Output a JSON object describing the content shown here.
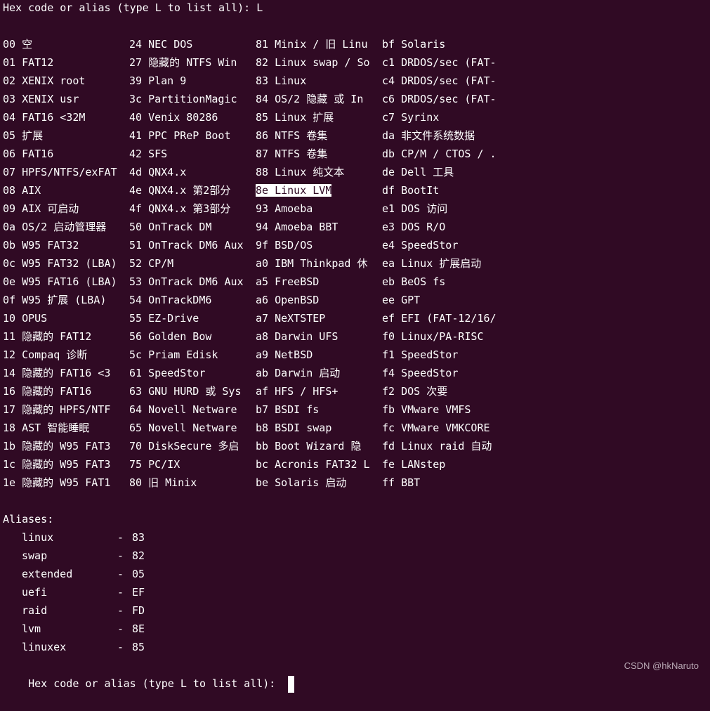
{
  "prompt": "Hex code or alias (type L to list all): L",
  "final_prompt": "Hex code or alias (type L to list all): ",
  "table": {
    "rows": [
      [
        {
          "code": "00",
          "name": "空"
        },
        {
          "code": "24",
          "name": "NEC DOS"
        },
        {
          "code": "81",
          "name": "Minix / 旧 Linu"
        },
        {
          "code": "bf",
          "name": "Solaris"
        }
      ],
      [
        {
          "code": "01",
          "name": "FAT12"
        },
        {
          "code": "27",
          "name": "隐藏的 NTFS Win"
        },
        {
          "code": "82",
          "name": "Linux swap / So"
        },
        {
          "code": "c1",
          "name": "DRDOS/sec (FAT-"
        }
      ],
      [
        {
          "code": "02",
          "name": "XENIX root"
        },
        {
          "code": "39",
          "name": "Plan 9"
        },
        {
          "code": "83",
          "name": "Linux"
        },
        {
          "code": "c4",
          "name": "DRDOS/sec (FAT-"
        }
      ],
      [
        {
          "code": "03",
          "name": "XENIX usr"
        },
        {
          "code": "3c",
          "name": "PartitionMagic"
        },
        {
          "code": "84",
          "name": "OS/2 隐藏 或 In"
        },
        {
          "code": "c6",
          "name": "DRDOS/sec (FAT-"
        }
      ],
      [
        {
          "code": "04",
          "name": "FAT16 <32M"
        },
        {
          "code": "40",
          "name": "Venix 80286"
        },
        {
          "code": "85",
          "name": "Linux 扩展"
        },
        {
          "code": "c7",
          "name": "Syrinx"
        }
      ],
      [
        {
          "code": "05",
          "name": "扩展"
        },
        {
          "code": "41",
          "name": "PPC PReP Boot"
        },
        {
          "code": "86",
          "name": "NTFS 卷集"
        },
        {
          "code": "da",
          "name": "非文件系统数据"
        }
      ],
      [
        {
          "code": "06",
          "name": "FAT16"
        },
        {
          "code": "42",
          "name": "SFS"
        },
        {
          "code": "87",
          "name": "NTFS 卷集"
        },
        {
          "code": "db",
          "name": "CP/M / CTOS / ."
        }
      ],
      [
        {
          "code": "07",
          "name": "HPFS/NTFS/exFAT"
        },
        {
          "code": "4d",
          "name": "QNX4.x"
        },
        {
          "code": "88",
          "name": "Linux 纯文本"
        },
        {
          "code": "de",
          "name": "Dell 工具"
        }
      ],
      [
        {
          "code": "08",
          "name": "AIX"
        },
        {
          "code": "4e",
          "name": "QNX4.x 第2部分"
        },
        {
          "code": "8e",
          "name": "Linux LVM"
        },
        {
          "code": "df",
          "name": "BootIt"
        }
      ],
      [
        {
          "code": "09",
          "name": "AIX 可启动"
        },
        {
          "code": "4f",
          "name": "QNX4.x 第3部分"
        },
        {
          "code": "93",
          "name": "Amoeba"
        },
        {
          "code": "e1",
          "name": "DOS 访问"
        }
      ],
      [
        {
          "code": "0a",
          "name": "OS/2 启动管理器"
        },
        {
          "code": "50",
          "name": "OnTrack DM"
        },
        {
          "code": "94",
          "name": "Amoeba BBT"
        },
        {
          "code": "e3",
          "name": "DOS R/O"
        }
      ],
      [
        {
          "code": "0b",
          "name": "W95 FAT32"
        },
        {
          "code": "51",
          "name": "OnTrack DM6 Aux"
        },
        {
          "code": "9f",
          "name": "BSD/OS"
        },
        {
          "code": "e4",
          "name": "SpeedStor"
        }
      ],
      [
        {
          "code": "0c",
          "name": "W95 FAT32 (LBA)"
        },
        {
          "code": "52",
          "name": "CP/M"
        },
        {
          "code": "a0",
          "name": "IBM Thinkpad 休"
        },
        {
          "code": "ea",
          "name": "Linux 扩展启动"
        }
      ],
      [
        {
          "code": "0e",
          "name": "W95 FAT16 (LBA)"
        },
        {
          "code": "53",
          "name": "OnTrack DM6 Aux"
        },
        {
          "code": "a5",
          "name": "FreeBSD"
        },
        {
          "code": "eb",
          "name": "BeOS fs"
        }
      ],
      [
        {
          "code": "0f",
          "name": "W95 扩展 (LBA)"
        },
        {
          "code": "54",
          "name": "OnTrackDM6"
        },
        {
          "code": "a6",
          "name": "OpenBSD"
        },
        {
          "code": "ee",
          "name": "GPT"
        }
      ],
      [
        {
          "code": "10",
          "name": "OPUS"
        },
        {
          "code": "55",
          "name": "EZ-Drive"
        },
        {
          "code": "a7",
          "name": "NeXTSTEP"
        },
        {
          "code": "ef",
          "name": "EFI (FAT-12/16/"
        }
      ],
      [
        {
          "code": "11",
          "name": "隐藏的 FAT12"
        },
        {
          "code": "56",
          "name": "Golden Bow"
        },
        {
          "code": "a8",
          "name": "Darwin UFS"
        },
        {
          "code": "f0",
          "name": "Linux/PA-RISC"
        }
      ],
      [
        {
          "code": "12",
          "name": "Compaq 诊断"
        },
        {
          "code": "5c",
          "name": "Priam Edisk"
        },
        {
          "code": "a9",
          "name": "NetBSD"
        },
        {
          "code": "f1",
          "name": "SpeedStor"
        }
      ],
      [
        {
          "code": "14",
          "name": "隐藏的 FAT16 <3"
        },
        {
          "code": "61",
          "name": "SpeedStor"
        },
        {
          "code": "ab",
          "name": "Darwin 启动"
        },
        {
          "code": "f4",
          "name": "SpeedStor"
        }
      ],
      [
        {
          "code": "16",
          "name": "隐藏的 FAT16"
        },
        {
          "code": "63",
          "name": "GNU HURD 或 Sys"
        },
        {
          "code": "af",
          "name": "HFS / HFS+"
        },
        {
          "code": "f2",
          "name": "DOS 次要"
        }
      ],
      [
        {
          "code": "17",
          "name": "隐藏的 HPFS/NTF"
        },
        {
          "code": "64",
          "name": "Novell Netware"
        },
        {
          "code": "b7",
          "name": "BSDI fs"
        },
        {
          "code": "fb",
          "name": "VMware VMFS"
        }
      ],
      [
        {
          "code": "18",
          "name": "AST 智能睡眠"
        },
        {
          "code": "65",
          "name": "Novell Netware"
        },
        {
          "code": "b8",
          "name": "BSDI swap"
        },
        {
          "code": "fc",
          "name": "VMware VMKCORE"
        }
      ],
      [
        {
          "code": "1b",
          "name": "隐藏的 W95 FAT3"
        },
        {
          "code": "70",
          "name": "DiskSecure 多启"
        },
        {
          "code": "bb",
          "name": "Boot Wizard 隐"
        },
        {
          "code": "fd",
          "name": "Linux raid 自动"
        }
      ],
      [
        {
          "code": "1c",
          "name": "隐藏的 W95 FAT3"
        },
        {
          "code": "75",
          "name": "PC/IX"
        },
        {
          "code": "bc",
          "name": "Acronis FAT32 L"
        },
        {
          "code": "fe",
          "name": "LANstep"
        }
      ],
      [
        {
          "code": "1e",
          "name": "隐藏的 W95 FAT1"
        },
        {
          "code": "80",
          "name": "旧 Minix"
        },
        {
          "code": "be",
          "name": "Solaris 启动"
        },
        {
          "code": "ff",
          "name": "BBT"
        }
      ]
    ],
    "highlighted": {
      "row": 8,
      "col": 2
    }
  },
  "aliases": {
    "heading": "Aliases:",
    "items": [
      {
        "name": "linux",
        "code": "83"
      },
      {
        "name": "swap",
        "code": "82"
      },
      {
        "name": "extended",
        "code": "05"
      },
      {
        "name": "uefi",
        "code": "EF"
      },
      {
        "name": "raid",
        "code": "FD"
      },
      {
        "name": "lvm",
        "code": "8E"
      },
      {
        "name": "linuxex",
        "code": "85"
      }
    ]
  },
  "watermark": "CSDN @hkNaruto",
  "colors": {
    "background": "#300a24",
    "foreground": "#ffffff"
  }
}
